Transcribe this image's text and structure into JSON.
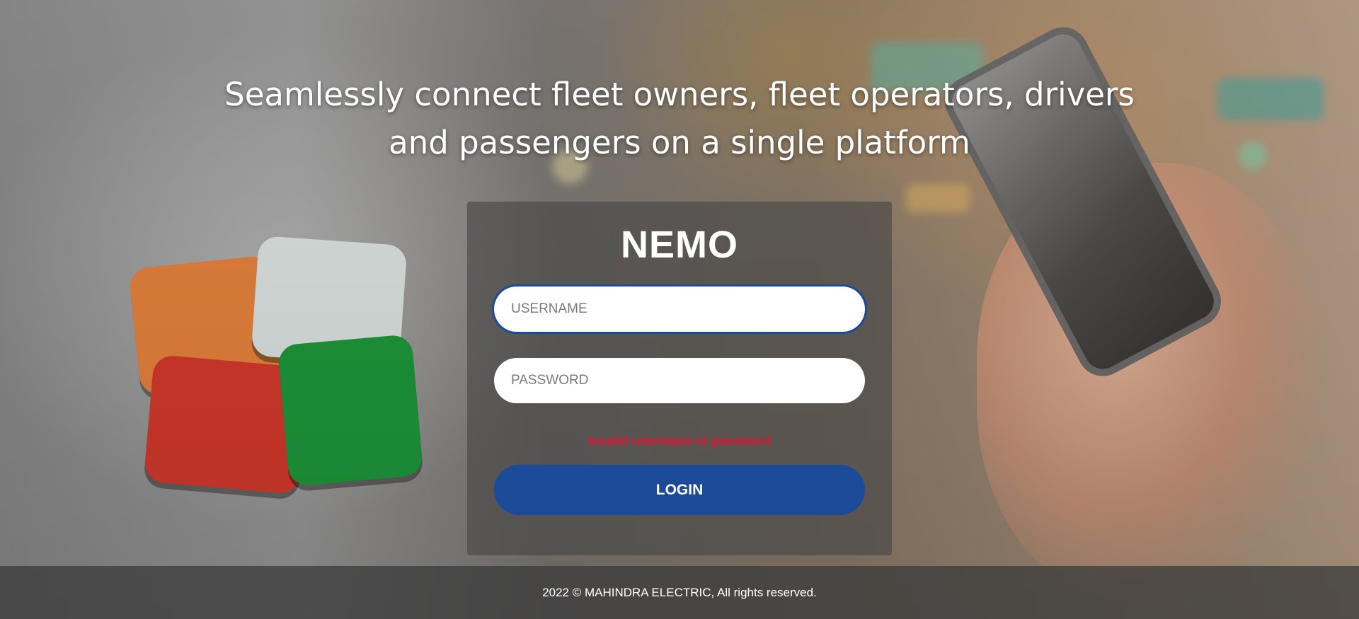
{
  "hero": {
    "tagline": "Seamlessly connect fleet owners, fleet operators, drivers and passengers on a single platform"
  },
  "login": {
    "brand": "NEMO",
    "username_placeholder": "USERNAME",
    "password_placeholder": "PASSWORD",
    "username_value": "",
    "password_value": "",
    "error_message": "Invalid username or password",
    "login_label": "LOGIN"
  },
  "footer": {
    "copyright": "2022 © MAHINDRA ELECTRIC, All rights reserved."
  },
  "colors": {
    "button": "#1b4a98",
    "error": "#e3122f",
    "focus_border": "#1a4a9a",
    "card_overlay": "rgba(70,70,70,0.62)"
  }
}
